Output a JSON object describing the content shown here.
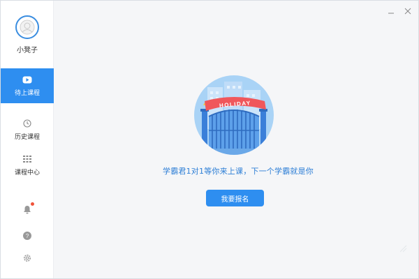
{
  "user": {
    "name": "小凳子"
  },
  "nav": {
    "items": [
      {
        "label": "待上课程",
        "icon": "play-icon",
        "active": true
      },
      {
        "label": "历史课程",
        "icon": "history-icon",
        "active": false
      },
      {
        "label": "课程中心",
        "icon": "grid-icon",
        "active": false
      }
    ]
  },
  "sidebar_bottom": {
    "icons": [
      "bell-icon",
      "help-icon",
      "gear-icon"
    ],
    "notification_dot": true
  },
  "window": {
    "controls": [
      "minimize-icon",
      "close-icon"
    ]
  },
  "main": {
    "banner_text": "HOLIDAY",
    "message": "学霸君1对1等你来上课，下一个学霸就是你",
    "button_label": "我要报名"
  },
  "colors": {
    "accent": "#2e8ef0",
    "message": "#2e7fd6",
    "banner": "#f0575b",
    "circle_bg": "#a9d3f6",
    "badge": "#f0533a"
  }
}
